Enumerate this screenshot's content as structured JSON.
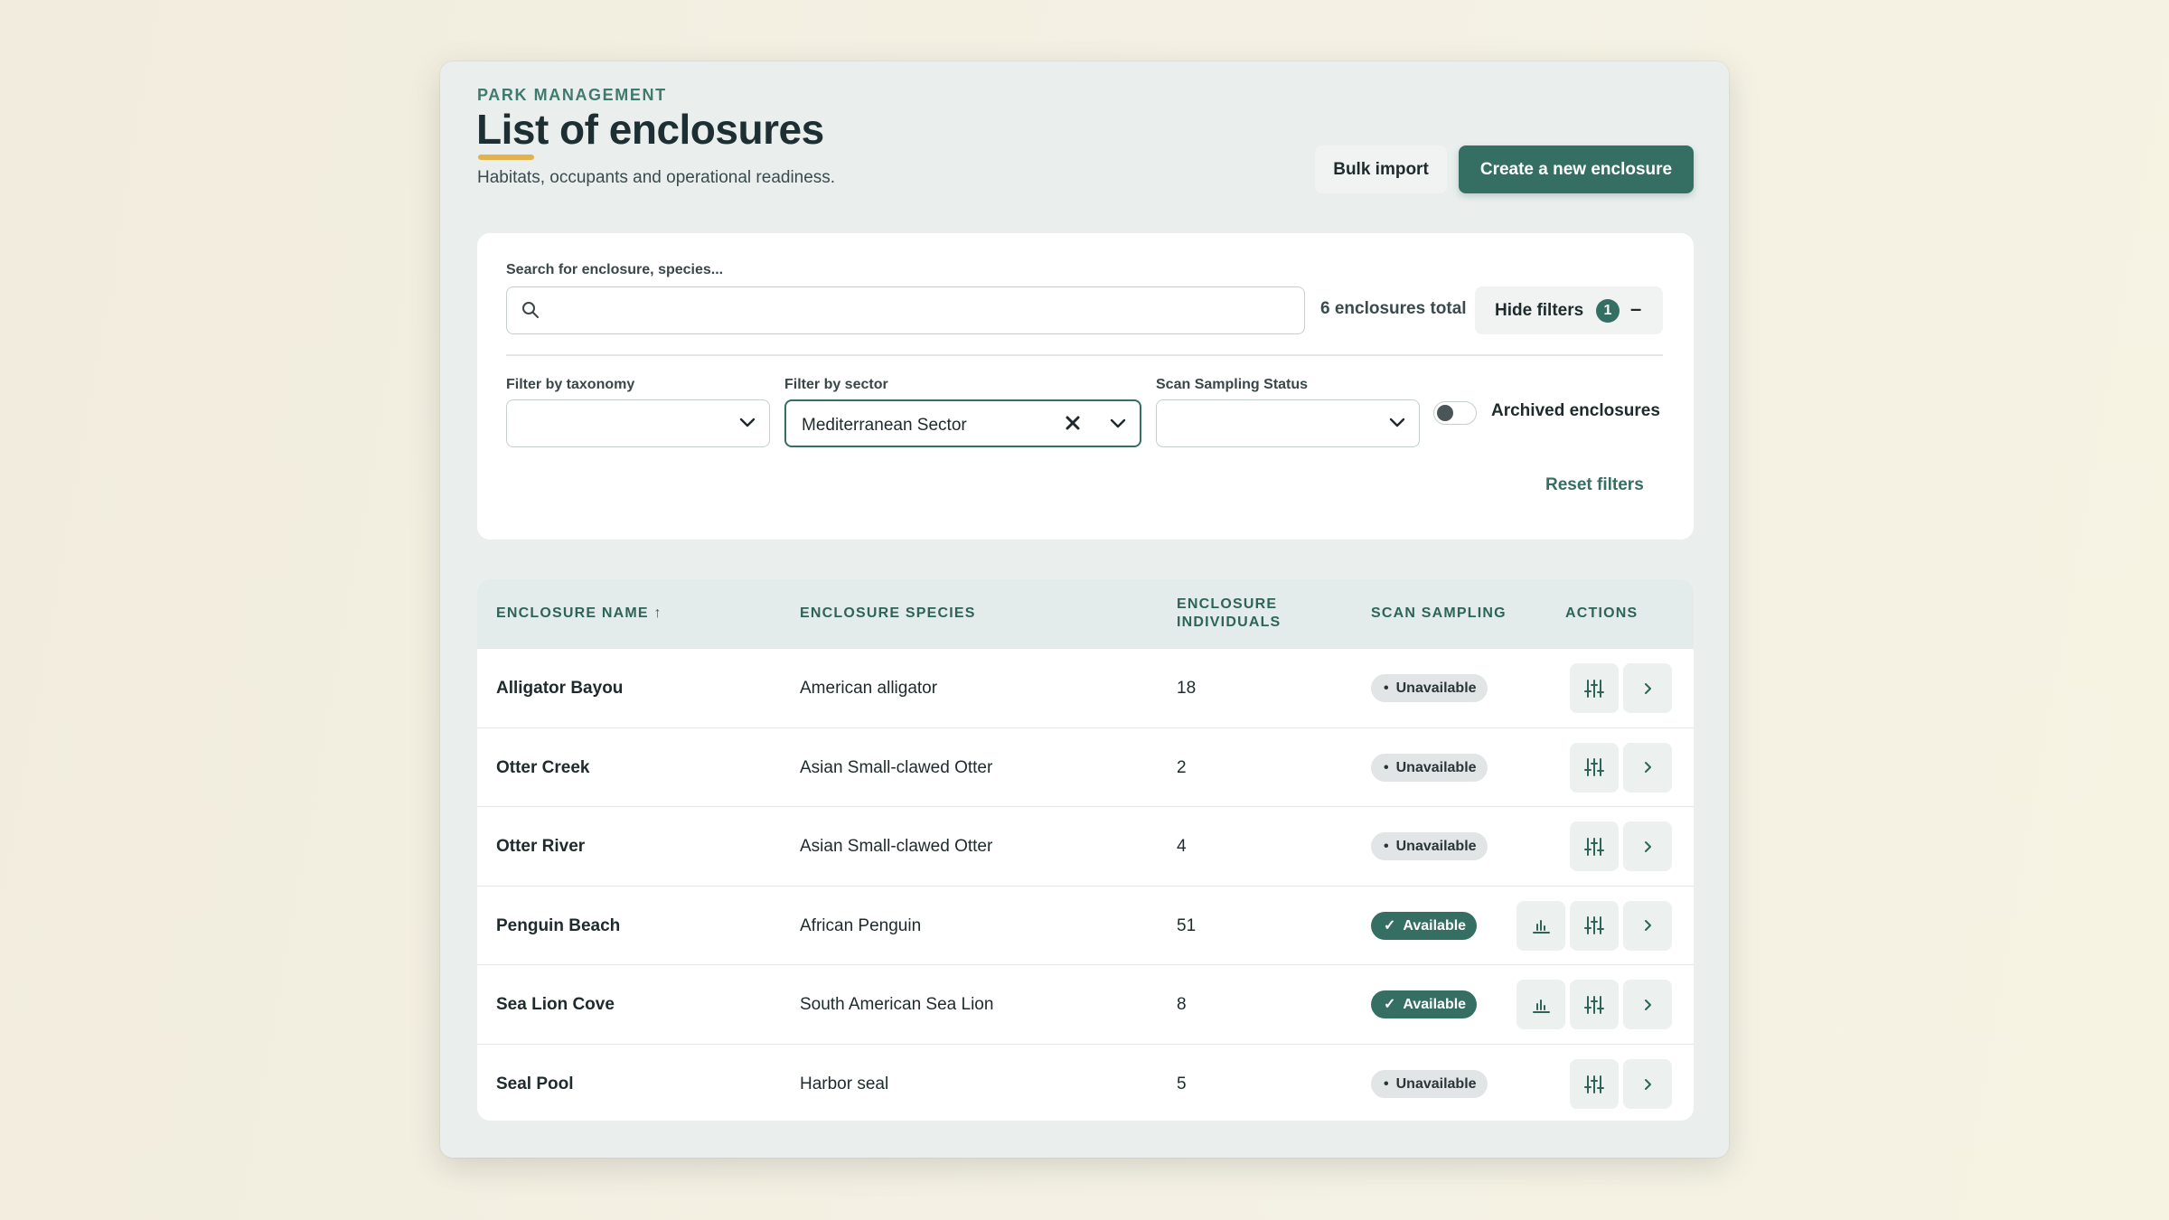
{
  "header": {
    "eyebrow": "PARK MANAGEMENT",
    "title": "List of enclosures",
    "subtitle": "Habitats, occupants and operational readiness.",
    "bulk_import_label": "Bulk import",
    "create_label": "Create a new enclosure"
  },
  "filters": {
    "search_label": "Search for enclosure, species...",
    "search_value": "",
    "total_text": "6 enclosures total",
    "hide_filters_label": "Hide filters",
    "active_filter_count": "1",
    "collapse_symbol": "–",
    "taxonomy_label": "Filter by taxonomy",
    "taxonomy_value": "",
    "sector_label": "Filter by sector",
    "sector_value": "Mediterranean Sector",
    "scan_status_label": "Scan Sampling Status",
    "scan_status_value": "",
    "archived_label": "Archived enclosures",
    "archived_on": false,
    "reset_label": "Reset filters"
  },
  "table": {
    "columns": {
      "name": "ENCLOSURE NAME",
      "sort_indicator": "↑",
      "species": "ENCLOSURE SPECIES",
      "individuals_line1": "ENCLOSURE",
      "individuals_line2": "INDIVIDUALS",
      "scan": "SCAN SAMPLING",
      "actions": "ACTIONS"
    },
    "rows": [
      {
        "name": "Alligator Bayou",
        "species": "American alligator",
        "individuals": "18",
        "status": "Unavailable"
      },
      {
        "name": "Otter Creek",
        "species": "Asian Small-clawed Otter",
        "individuals": "2",
        "status": "Unavailable"
      },
      {
        "name": "Otter River",
        "species": "Asian Small-clawed Otter",
        "individuals": "4",
        "status": "Unavailable"
      },
      {
        "name": "Penguin Beach",
        "species": "African Penguin",
        "individuals": "51",
        "status": "Available"
      },
      {
        "name": "Sea Lion Cove",
        "species": "South American Sea Lion",
        "individuals": "8",
        "status": "Available"
      },
      {
        "name": "Seal Pool",
        "species": "Harbor seal",
        "individuals": "5",
        "status": "Unavailable"
      }
    ]
  },
  "icons": {
    "search": "search-icon",
    "chevron": "chevron-down-icon",
    "clear": "close-icon",
    "stats": "bar-chart-icon",
    "settings": "sliders-icon",
    "open": "chevron-right-icon"
  },
  "colors": {
    "accent": "#356e63",
    "underline": "#e4b24a",
    "header_bg": "#e3eceb",
    "unavailable_bg": "#e1e5e5"
  }
}
